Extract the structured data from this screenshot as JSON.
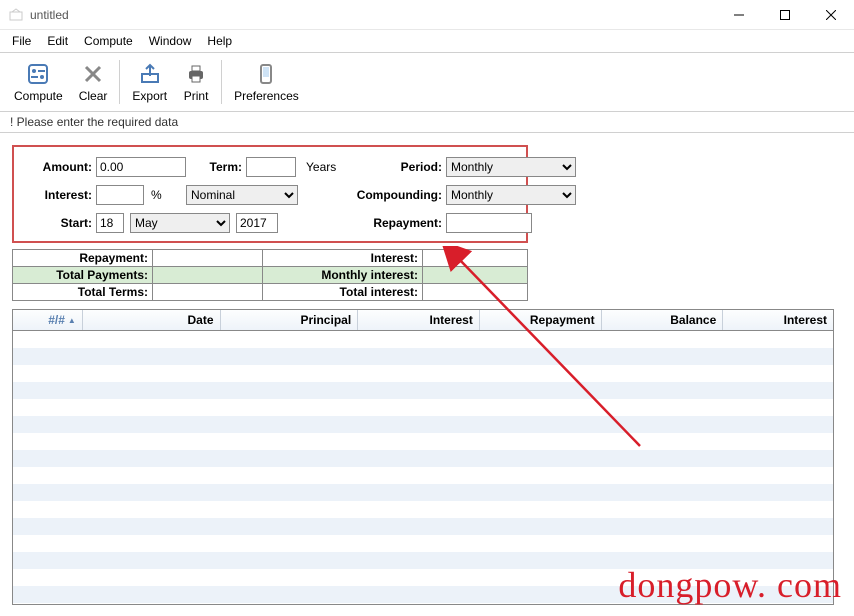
{
  "window": {
    "title": "untitled"
  },
  "menu": {
    "file": "File",
    "edit": "Edit",
    "compute": "Compute",
    "window": "Window",
    "help": "Help"
  },
  "toolbar": {
    "compute": "Compute",
    "clear": "Clear",
    "export": "Export",
    "print": "Print",
    "preferences": "Preferences"
  },
  "status": {
    "message": "!   Please enter the required data"
  },
  "form": {
    "amount_label": "Amount:",
    "amount_value": "0.00",
    "term_label": "Term:",
    "term_value": "",
    "term_unit": "Years",
    "period_label": "Period:",
    "period_value": "Monthly",
    "interest_label": "Interest:",
    "interest_value": "",
    "percent": "%",
    "interest_type": "Nominal",
    "compounding_label": "Compounding:",
    "compounding_value": "Monthly",
    "start_label": "Start:",
    "start_day": "18",
    "start_month": "May",
    "start_year": "2017",
    "repayment_label": "Repayment:",
    "repayment_value": ""
  },
  "summary": {
    "repayment_l": "Repayment:",
    "repayment_v": "",
    "interest_l": "Interest:",
    "interest_v": "",
    "total_payments_l": "Total Payments:",
    "total_payments_v": "",
    "monthly_interest_l": "Monthly interest:",
    "monthly_interest_v": "",
    "total_terms_l": "Total Terms:",
    "total_terms_v": "",
    "total_interest_l": "Total interest:",
    "total_interest_v": ""
  },
  "table": {
    "headers": [
      "#/#",
      "Date",
      "Principal",
      "Interest",
      "Repayment",
      "Balance",
      "Interest"
    ]
  },
  "watermark": "dongpow. com"
}
